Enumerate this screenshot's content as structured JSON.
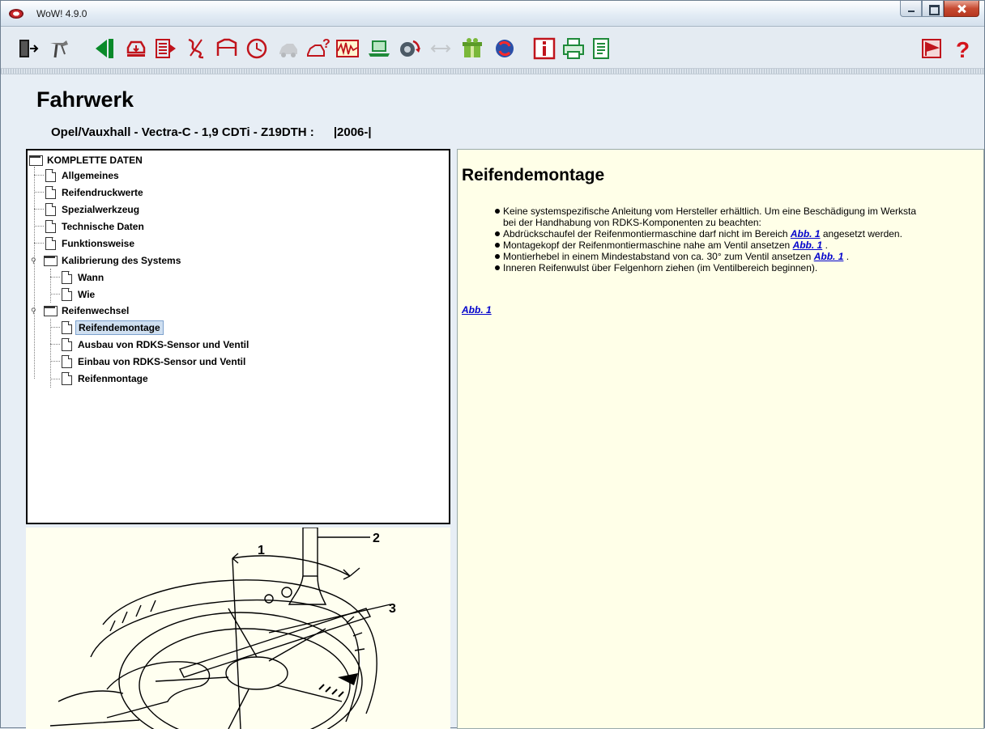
{
  "window": {
    "title": "WoW! 4.9.0"
  },
  "toolbar": {
    "icons": [
      "exit-door-icon",
      "tools-icon",
      "back-arrow-icon",
      "car-lift-icon",
      "book-icon",
      "wiring-icon",
      "car-frame-icon",
      "clock-icon",
      "car-disabled-icon",
      "car-question-icon",
      "oscilloscope-icon",
      "laptop-diagnosis-icon",
      "car-rotate-icon",
      "arrow-disabled-icon",
      "gift-icon",
      "sync-icon",
      "info-icon",
      "printer-icon",
      "notepad-icon",
      "flag-icon",
      "help-icon"
    ]
  },
  "header": {
    "title": "Fahrwerk",
    "vehicle": "Opel/Vauxhall - Vectra-C - 1,9 CDTi - Z19DTH :",
    "years": "|2006-|"
  },
  "tree": {
    "root": "KOMPLETTE DATEN",
    "items": [
      {
        "label": "Allgemeines"
      },
      {
        "label": "Reifendruckwerte"
      },
      {
        "label": "Spezialwerkzeug"
      },
      {
        "label": "Technische Daten"
      },
      {
        "label": "Funktionsweise"
      },
      {
        "label": "Kalibrierung des Systems"
      },
      {
        "label": "Wann"
      },
      {
        "label": "Wie"
      },
      {
        "label": "Reifenwechsel"
      },
      {
        "label": "Reifendemontage"
      },
      {
        "label": "Ausbau von RDKS-Sensor und Ventil"
      },
      {
        "label": "Einbau von RDKS-Sensor und Ventil"
      },
      {
        "label": "Reifenmontage"
      }
    ],
    "selected": "Reifendemontage"
  },
  "figure": {
    "callouts": [
      "1",
      "2",
      "3"
    ]
  },
  "content": {
    "title": "Reifendemontage",
    "bullets": {
      "b1_line1": "Keine systemspezifische Anleitung vom Hersteller erhältlich. Um eine Beschädigung im Werksta",
      "b1_line2": "bei der Handhabung von RDKS-Komponenten zu beachten:",
      "b2_text": "Abdrückschaufel der Reifenmontiermaschine darf nicht im Bereich",
      "b2_after": "angesetzt werden.",
      "b3_text": "Montagekopf der Reifenmontiermaschine nahe am Ventil ansetzen",
      "b3_after": ".",
      "b4_text": "Montierhebel in einem Mindestabstand von ca. 30° zum Ventil ansetzen",
      "b4_after": ".",
      "b5_text": "Inneren Reifenwulst über Felgenhorn ziehen (im Ventilbereich beginnen)."
    },
    "link_label": "Abb. 1",
    "figure_link": "Abb. 1"
  }
}
